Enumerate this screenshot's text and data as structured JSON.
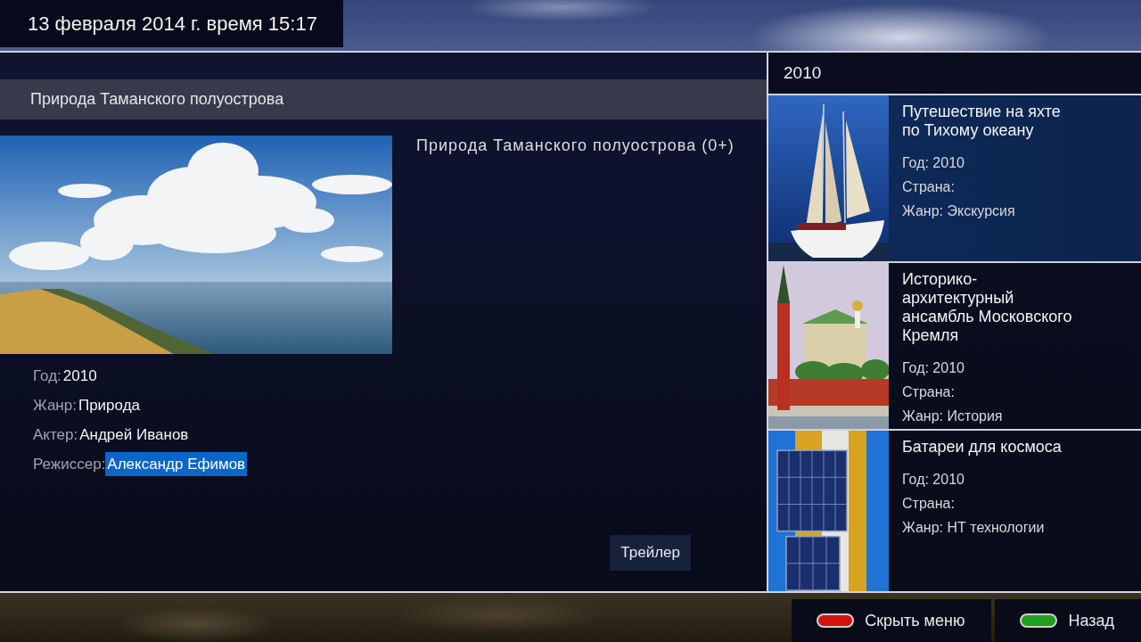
{
  "datetime": "13 февраля 2014 г. время 15:17",
  "details": {
    "header": "Природа Таманского полуострова",
    "title": "Природа Таманского полуострова (0+)",
    "fields": [
      {
        "label": "Год:",
        "value": "2010",
        "selected": false
      },
      {
        "label": "Жанр:",
        "value": "Природа",
        "selected": false
      },
      {
        "label": "Актер:",
        "value": "Андрей Иванов",
        "selected": false
      },
      {
        "label": "Режиссер:",
        "value": "Александр Ефимов",
        "selected": true
      }
    ],
    "trailer_button": "Трейлер"
  },
  "catalog": {
    "header": "2010",
    "items": [
      {
        "title_lines": [
          "Путешествие на яхте",
          "по Тихому океану"
        ],
        "fields": [
          "Год: 2010",
          "Страна:",
          "Жанр: Экскурсия"
        ],
        "selected": true
      },
      {
        "title_lines": [
          "Историко-",
          "архитектурный",
          "ансамбль Московского",
          "Кремля"
        ],
        "fields": [
          "Год: 2010",
          "Страна:",
          "Жанр: История"
        ],
        "selected": false
      },
      {
        "title_lines": [
          "Батареи для космоса"
        ],
        "fields": [
          "Год: 2010",
          "Страна:",
          "Жанр: НТ технологии"
        ],
        "selected": false
      }
    ]
  },
  "hints": [
    {
      "label": "Скрыть меню",
      "color": "#d01414"
    },
    {
      "label": "Назад",
      "color": "#1ea01e"
    }
  ]
}
